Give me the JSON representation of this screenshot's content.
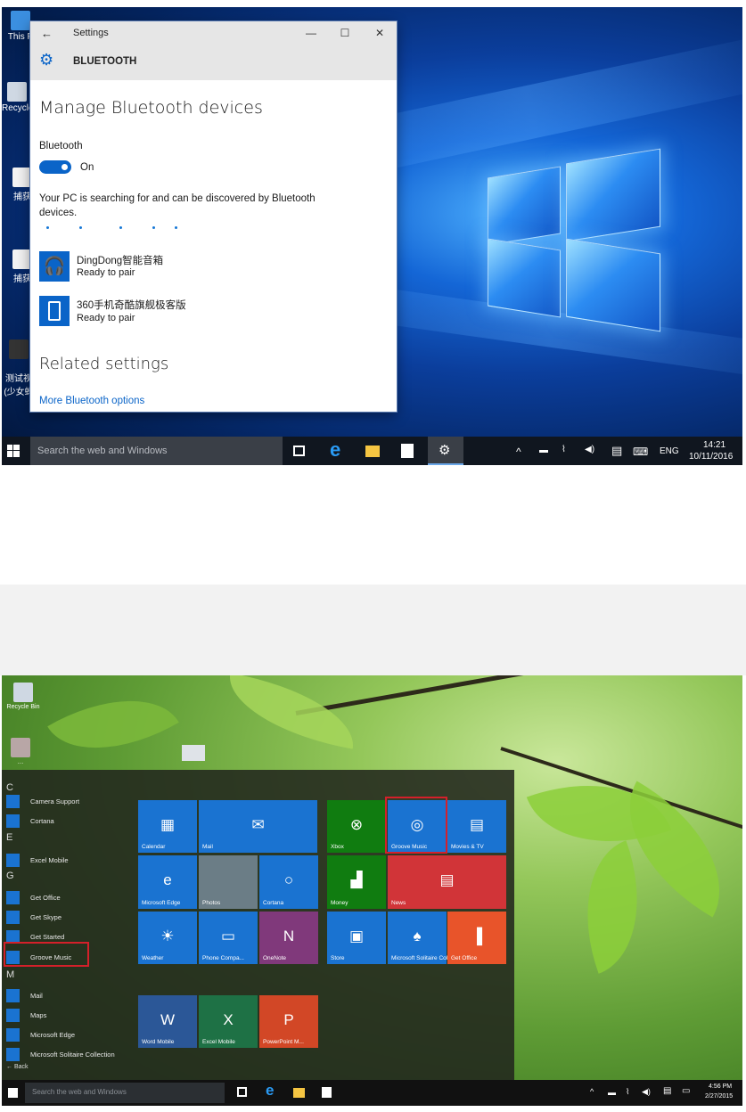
{
  "screen1": {
    "desktop_icons": [
      "This P",
      "Recycle",
      "捕获",
      "捕获",
      "测试视\n(少女蚂"
    ],
    "settings": {
      "title": "Settings",
      "section": "BLUETOOTH",
      "heading": "Manage Bluetooth devices",
      "bluetooth_label": "Bluetooth",
      "toggle_state": "On",
      "searching_text": "Your PC is searching for and can be discovered by Bluetooth devices.",
      "devices": [
        {
          "name": "DingDong智能音箱",
          "status": "Ready to pair",
          "icon": "headphones-icon"
        },
        {
          "name": "360手机奇酷旗舰极客版",
          "status": "Ready to pair",
          "icon": "phone-icon"
        }
      ],
      "related_heading": "Related settings",
      "more_link": "More Bluetooth options"
    },
    "taskbar": {
      "search_placeholder": "Search the web and Windows",
      "language": "ENG",
      "time": "14:21",
      "date": "10/11/2016"
    }
  },
  "screen2": {
    "desktop_icons": [
      "Recycle Bin",
      "…"
    ],
    "start_list": [
      {
        "type": "letter",
        "text": "C"
      },
      {
        "type": "item",
        "text": "Camera Support"
      },
      {
        "type": "item",
        "text": "Cortana"
      },
      {
        "type": "letter",
        "text": "E"
      },
      {
        "type": "item",
        "text": "Excel Mobile"
      },
      {
        "type": "letter",
        "text": "G"
      },
      {
        "type": "item",
        "text": "Get Office"
      },
      {
        "type": "item",
        "text": "Get Skype"
      },
      {
        "type": "item",
        "text": "Get Started"
      },
      {
        "type": "item",
        "text": "Groove Music"
      },
      {
        "type": "letter",
        "text": "M"
      },
      {
        "type": "item",
        "text": "Mail"
      },
      {
        "type": "item",
        "text": "Maps"
      },
      {
        "type": "item",
        "text": "Microsoft Edge"
      },
      {
        "type": "item",
        "text": "Microsoft Solitaire Collection"
      }
    ],
    "back_label": "Back",
    "tiles": [
      {
        "label": "Calendar",
        "glyph": "▦",
        "color": "#1a73d1"
      },
      {
        "label": "Mail",
        "glyph": "✉",
        "color": "#1a73d1"
      },
      {
        "label": "Microsoft Edge",
        "glyph": "e",
        "color": "#1a73d1"
      },
      {
        "label": "Photos",
        "glyph": "",
        "color": "#6b7d86"
      },
      {
        "label": "Cortana",
        "glyph": "○",
        "color": "#1a73d1"
      },
      {
        "label": "Weather",
        "glyph": "☀",
        "color": "#1a73d1"
      },
      {
        "label": "Phone Compa...",
        "glyph": "▭",
        "color": "#1a73d1"
      },
      {
        "label": "OneNote",
        "glyph": "N",
        "color": "#80397b"
      },
      {
        "label": "Xbox",
        "glyph": "⊗",
        "color": "#107c10"
      },
      {
        "label": "Groove Music",
        "glyph": "◎",
        "color": "#1a73d1"
      },
      {
        "label": "Movies & TV",
        "glyph": "▤",
        "color": "#1a73d1"
      },
      {
        "label": "Money",
        "glyph": "▟",
        "color": "#107c10"
      },
      {
        "label": "News",
        "glyph": "▤",
        "color": "#d13438"
      },
      {
        "label": "Store",
        "glyph": "▣",
        "color": "#1a73d1"
      },
      {
        "label": "Microsoft Solitaire Collection",
        "glyph": "♠",
        "color": "#1a73d1"
      },
      {
        "label": "Get Office",
        "glyph": "▐",
        "color": "#e8542a"
      },
      {
        "label": "Word Mobile",
        "glyph": "W",
        "color": "#2b5797"
      },
      {
        "label": "Excel Mobile",
        "glyph": "X",
        "color": "#1e7145"
      },
      {
        "label": "PowerPoint M...",
        "glyph": "P",
        "color": "#d24726"
      }
    ],
    "taskbar": {
      "search_placeholder": "Search the web and Windows",
      "time": "4:56 PM",
      "date": "2/27/2015"
    }
  }
}
